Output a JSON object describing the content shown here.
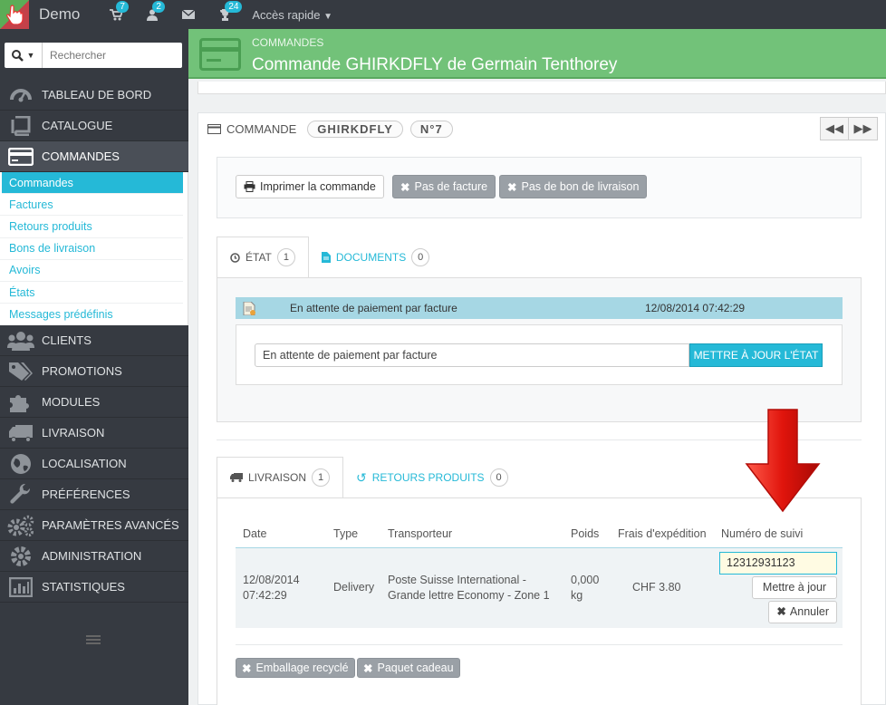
{
  "topbar": {
    "brand": "Demo",
    "cart_count": "7",
    "customers_count": "2",
    "messages_count": "",
    "trophy_count": "24",
    "quick_access": "Accès rapide"
  },
  "search": {
    "placeholder": "Rechercher"
  },
  "sidebar": {
    "items": [
      {
        "label": "TABLEAU DE BORD",
        "icon": "dashboard-icon"
      },
      {
        "label": "CATALOGUE",
        "icon": "book-icon"
      },
      {
        "label": "COMMANDES",
        "icon": "credit-card-icon"
      },
      {
        "label": "CLIENTS",
        "icon": "users-icon"
      },
      {
        "label": "PROMOTIONS",
        "icon": "tags-icon"
      },
      {
        "label": "MODULES",
        "icon": "puzzle-icon"
      },
      {
        "label": "LIVRAISON",
        "icon": "truck-icon"
      },
      {
        "label": "LOCALISATION",
        "icon": "globe-icon"
      },
      {
        "label": "PRÉFÉRENCES",
        "icon": "wrench-icon"
      },
      {
        "label": "PARAMÈTRES AVANCÉS",
        "icon": "cogs-icon"
      },
      {
        "label": "ADMINISTRATION",
        "icon": "gear-icon"
      },
      {
        "label": "STATISTIQUES",
        "icon": "bar-chart-icon"
      }
    ],
    "submenu": [
      "Commandes",
      "Factures",
      "Retours produits",
      "Bons de livraison",
      "Avoirs",
      "États",
      "Messages prédéfinis"
    ]
  },
  "header": {
    "breadcrumb": "COMMANDES",
    "title": "Commande GHIRKDFLY de Germain Tenthorey"
  },
  "order": {
    "label": "COMMANDE",
    "reference": "GHIRKDFLY",
    "number": "N°7"
  },
  "actions": {
    "print": "Imprimer la commande",
    "no_invoice": "Pas de facture",
    "no_delivery_slip": "Pas de bon de livraison"
  },
  "status_tabs": {
    "state_label": "ÉTAT",
    "state_count": "1",
    "documents_label": "DOCUMENTS",
    "documents_count": "0"
  },
  "status_history": {
    "status": "En attente de paiement par facture",
    "date": "12/08/2014 07:42:29"
  },
  "status_form": {
    "selected": "En attente de paiement par facture",
    "update_button": "METTRE À JOUR L'ÉTAT"
  },
  "shipping_tabs": {
    "shipping_label": "LIVRAISON",
    "shipping_count": "1",
    "returns_label": "RETOURS PRODUITS",
    "returns_count": "0"
  },
  "shipping_table": {
    "headers": [
      "Date",
      "Type",
      "Transporteur",
      "Poids",
      "Frais d'expédition",
      "Numéro de suivi"
    ],
    "row": {
      "date": "12/08/2014 07:42:29",
      "type": "Delivery",
      "carrier": "Poste Suisse International - Grande lettre Economy - Zone 1",
      "weight": "0,000 kg",
      "cost": "CHF 3.80",
      "tracking": "12312931123",
      "update_button": "Mettre à jour",
      "cancel_button": "Annuler"
    }
  },
  "options": {
    "recycled": "Emballage recyclé",
    "gift": "Paquet cadeau"
  },
  "colors": {
    "accent": "#25b9d7",
    "header_green": "#72c279",
    "arrow_red": "#e0140c"
  }
}
